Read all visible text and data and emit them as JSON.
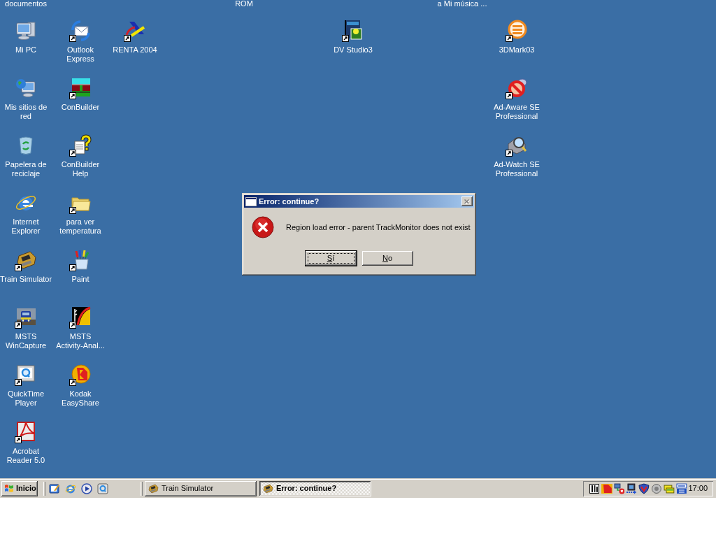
{
  "desktop": {
    "top_row_labels": [
      "documentos",
      "ROM",
      "a Mi música ..."
    ],
    "icons": [
      {
        "label": "Mi PC",
        "shortcut": false
      },
      {
        "label": "Outlook Express",
        "shortcut": true
      },
      {
        "label": "RENTA 2004",
        "shortcut": true
      },
      {
        "label": "DV Studio3",
        "shortcut": true
      },
      {
        "label": "3DMark03",
        "shortcut": true
      },
      {
        "label": "Mis sitios de red",
        "shortcut": false
      },
      {
        "label": "ConBuilder",
        "shortcut": true
      },
      {
        "label": "Ad-Aware SE Professional",
        "shortcut": true
      },
      {
        "label": "Papelera de reciclaje",
        "shortcut": false
      },
      {
        "label": "ConBuilder Help",
        "shortcut": true
      },
      {
        "label": "Ad-Watch SE Professional",
        "shortcut": true
      },
      {
        "label": "Internet Explorer",
        "shortcut": false
      },
      {
        "label": "para ver temperatura",
        "shortcut": true
      },
      {
        "label": "Train Simulator",
        "shortcut": true
      },
      {
        "label": "Paint",
        "shortcut": true
      },
      {
        "label": "MSTS WinCapture",
        "shortcut": true
      },
      {
        "label": "MSTS Activity-Anal...",
        "shortcut": true
      },
      {
        "label": "QuickTime Player",
        "shortcut": true
      },
      {
        "label": "Kodak EasyShare",
        "shortcut": true
      },
      {
        "label": "Acrobat Reader 5.0",
        "shortcut": true
      }
    ]
  },
  "dialog": {
    "title": "Error: continue?",
    "close_disabled": true,
    "message": "Region load error - parent TrackMonitor does not exist",
    "buttons": [
      {
        "label": "Sí",
        "focused": true,
        "mnemonic": true
      },
      {
        "label": "No",
        "focused": false,
        "mnemonic": true
      }
    ]
  },
  "taskbar": {
    "start_label": "Inicio",
    "windows": [
      {
        "label": "Train Simulator",
        "selected": false
      },
      {
        "label": "Error: continue?",
        "selected": true
      }
    ],
    "clock": "17:00"
  }
}
